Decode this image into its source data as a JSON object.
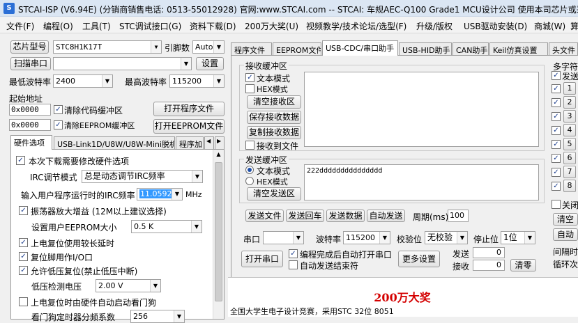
{
  "title": "STCAI-ISP (V6.94E) (分销商销售电话: 0513-55012928) 官网:www.STCAI.com  -- STCAI: 车规AEC-Q100 Grade1 MCU设计公司 使用本司芯片或采",
  "menu": [
    "文件(F)",
    "编程(O)",
    "工具(T)",
    "STC调试接口(G)",
    "资料下载(D)",
    "200万大奖(U)",
    "视频教学/技术论坛/选型(F)",
    "升级/版权",
    "USB驱动安装(D)",
    "商城(W)",
    "算"
  ],
  "left": {
    "chip_btn": "芯片型号",
    "chip_value": "STC8H1K17T",
    "pin_label": "引脚数",
    "pin_value": "Auto",
    "scan_btn": "扫描串口",
    "port_value": "",
    "settings_btn": "设置",
    "min_baud_label": "最低波特率",
    "min_baud_value": "2400",
    "max_baud_label": "最高波特率",
    "max_baud_value": "115200",
    "start_addr_label": "起始地址",
    "addr1": "0x0000",
    "clear_code_label": "清除代码缓冲区",
    "open_prog_btn": "打开程序文件",
    "addr2": "0x0000",
    "clear_eeprom_label": "清除EEPROM缓冲区",
    "open_eeprom_btn": "打开EEPROM文件",
    "tabs": [
      "硬件选项",
      "USB-Link1D/U8W/U8W-Mini脱机",
      "程序加"
    ],
    "hw": {
      "opt_modify": "本次下载需要修改硬件选项",
      "irc_mode_label": "IRC调节模式",
      "irc_mode_value": "总是动态调节IRC频率",
      "irc_freq_label": "输入用户程序运行时的IRC频率",
      "irc_freq_value": "11.0592",
      "irc_freq_unit": "MHz",
      "osc_gain": "振荡器放大增益 (12M以上建议选择)",
      "eeprom_size_label": "设置用户EEPROM大小",
      "eeprom_size_value": "0.5 K",
      "por_delay": "上电复位使用较长延时",
      "reset_io": "复位脚用作I/O口",
      "lvr": "允许低压复位(禁止低压中断)",
      "lvd_label": "低压检测电压",
      "lvd_value": "2.00 V",
      "wdt_auto": "上电复位时由硬件自动启动看门狗",
      "wdt_div_label": "看门狗定时器分频系数",
      "wdt_div_value": "256"
    }
  },
  "right": {
    "tabs": [
      "程序文件",
      "EEPROM文件",
      "USB-CDC/串口助手",
      "USB-HID助手",
      "CAN助手",
      "Keil仿真设置",
      "头文件"
    ],
    "rx": {
      "group": "接收缓冲区",
      "text_mode": "文本模式",
      "hex_mode": "HEX模式",
      "clear_btn": "清空接收区",
      "save_btn": "保存接收数据",
      "copy_btn": "复制接收数据",
      "to_file": "接收到文件"
    },
    "tx": {
      "group": "发送缓冲区",
      "text_mode": "文本模式",
      "hex_mode": "HEX模式",
      "clear_btn": "清空发送区",
      "content": "222ddddddddddddddd"
    },
    "send_file_btn": "发送文件",
    "send_cr_btn": "发送回车",
    "send_data_btn": "发送数据",
    "auto_send_btn": "自动发送",
    "period_label": "周期(ms)",
    "period_value": "100",
    "port_label": "串口",
    "port_value": "",
    "baud_label": "波特率",
    "baud_value": "115200",
    "parity_label": "校验位",
    "parity_value": "无校验",
    "stop_label": "停止位",
    "stop_value": "1位",
    "open_port_btn": "打开串口",
    "auto_open": "编程完成后自动打开串口",
    "auto_end": "自动发送结束符",
    "more_btn": "更多设置",
    "sent_label": "发送",
    "sent_value": "0",
    "recv_label": "接收",
    "recv_value": "0",
    "clear_btn": "清零",
    "multi": {
      "title": "多字符",
      "send_label": "发送",
      "nums": [
        "1",
        "2",
        "3",
        "4",
        "5",
        "6",
        "7",
        "8"
      ],
      "close_label": "关闭",
      "clear_btn": "清空",
      "auto_btn": "自动",
      "interval": "间隔时",
      "loop": "循环次"
    },
    "promo_title": "200万大奖",
    "promo_text": "全国大学生电子设计竞赛，采用STC 32位 8051"
  }
}
